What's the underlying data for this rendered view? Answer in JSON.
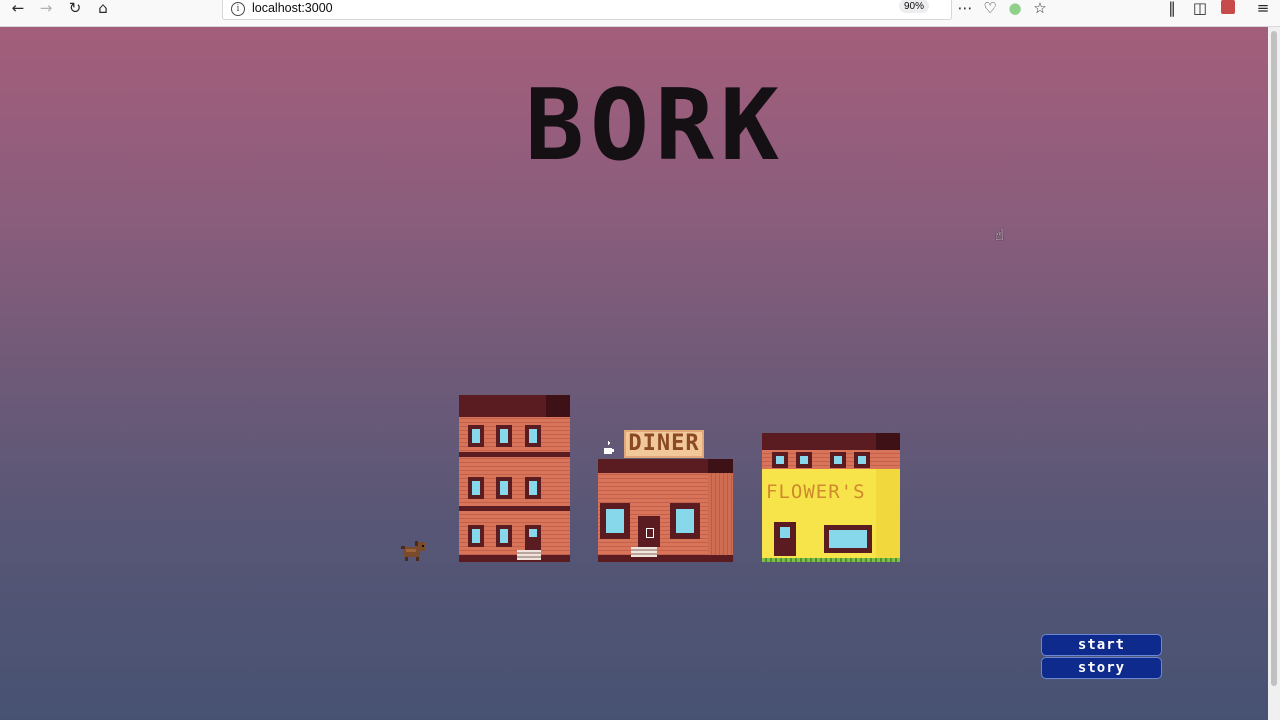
{
  "browser": {
    "url": "localhost:3000",
    "zoom": "90%",
    "icons": [
      "back-arrow-icon",
      "forward-arrow-icon",
      "reload-icon",
      "home-icon",
      "site-info-icon",
      "page-actions-icon",
      "pocket-icon",
      "extension-icon",
      "bookmark-star-icon",
      "library-icon",
      "sidebar-icon",
      "account-icon",
      "hamburger-menu-icon"
    ]
  },
  "game": {
    "title": "BORK",
    "buildings": {
      "diner_sign": "DINER",
      "flower_sign": "FLOWER'S"
    },
    "menu": {
      "start_label": "start",
      "story_label": "story"
    },
    "colors": {
      "sky_top": "#a35e7b",
      "sky_bottom": "#475272",
      "brick": "#d8745a",
      "roof": "#5a1c21",
      "window_glass": "#87d8ea",
      "flower_shop_wall": "#f7e44a",
      "button_bg": "#0d2a8c"
    }
  }
}
